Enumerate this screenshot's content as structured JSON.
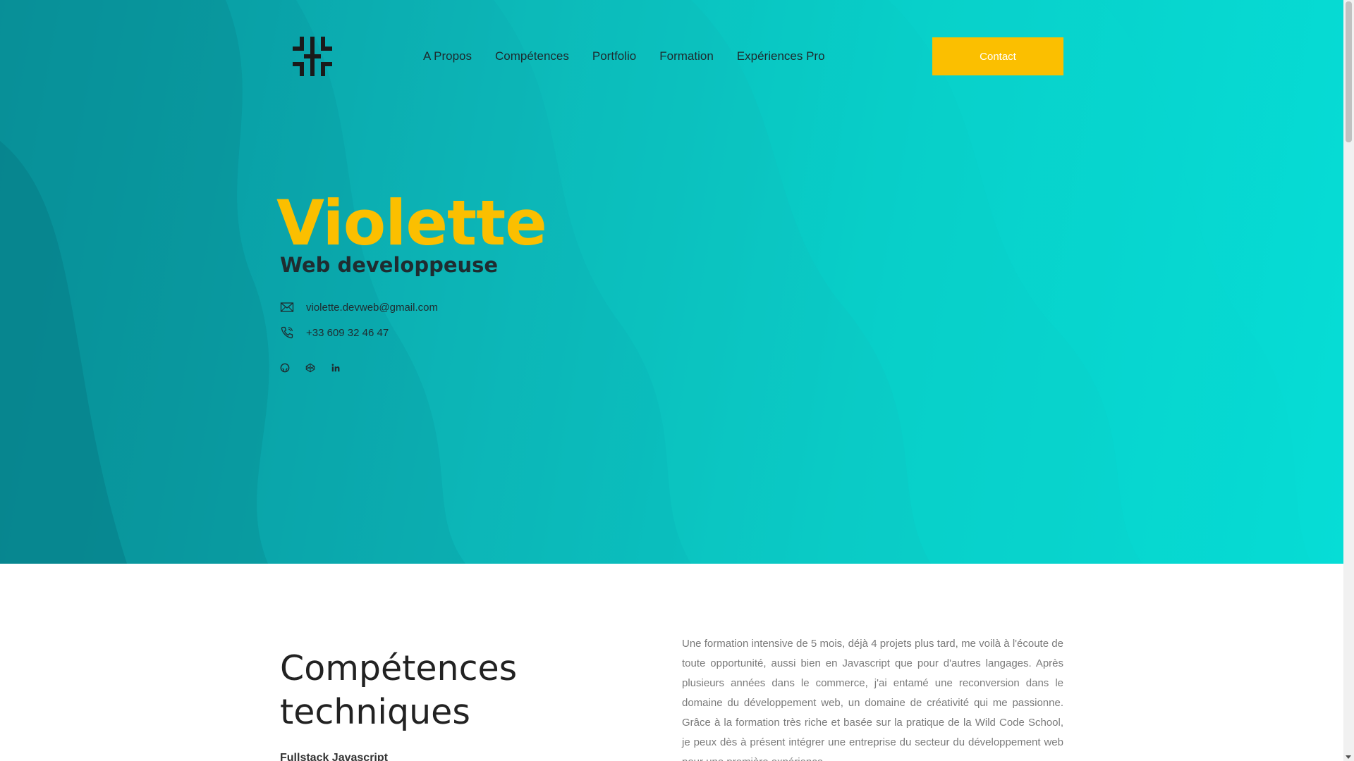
{
  "brand": {
    "logo_icon": "interlocking-bracket-logo-icon"
  },
  "nav": {
    "items": [
      {
        "label": "A Propos",
        "active": true
      },
      {
        "label": "Compétences",
        "active": false
      },
      {
        "label": "Portfolio",
        "active": false
      },
      {
        "label": "Formation",
        "active": false
      },
      {
        "label": "Expériences Pro",
        "active": false
      }
    ],
    "contact_label": "Contact"
  },
  "hero": {
    "name": "Violette",
    "role": "Web developpeuse",
    "email": "violette.devweb@gmail.com",
    "phone": "+33 609 32 46 47",
    "socials": [
      "github-icon",
      "codepen-icon",
      "linkedin-icon"
    ]
  },
  "skills": {
    "title": "Compétences techniques",
    "subtitle": "Fullstack Javascript"
  },
  "about": {
    "text": "Une formation intensive de 5 mois, déjà 4 projets plus tard, me voilà à l'écoute de toute opportunité, aussi bien en Javascript que pour d'autres langages. Après plusieurs années dans le commerce, j'ai entamé une reconversion dans le domaine du développement web, un domaine de créativité qui me passionne. Grâce à la formation très riche et basée sur la pratique de la Wild Code School, je peux dès à présent intégrer une entreprise du secteur du développement web pour une première expérience."
  },
  "colors": {
    "accent": "#fbbf00",
    "hero_teal_dark": "#078f99",
    "hero_teal_light": "#06ddd6",
    "text_dark": "#1f2c30",
    "text_muted": "#7a7a7a"
  }
}
